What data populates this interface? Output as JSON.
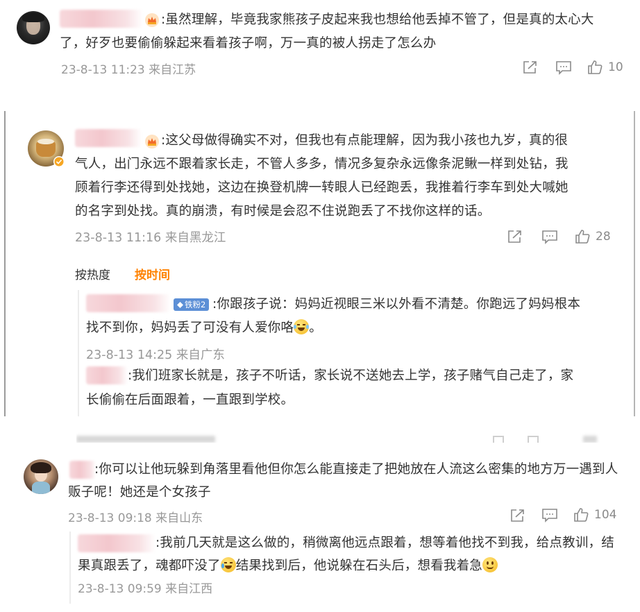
{
  "comments": [
    {
      "text": "虽然理解，毕竟我家熊孩子皮起来我也想给他丢掉不管了，但是真的太心大了，好歹也要偷偷躲起来看着孩子啊，万一真的被人拐走了怎么办",
      "text_line1": ":虽然理解，毕竟我家熊孩子皮起来我也想给他丢掉不管了，但是真的太心大",
      "text_line2": "了，好歹也要偷偷躲起来看着孩子啊，万一真的被人拐走了怎么办",
      "time": "23-8-13 11:23 来自江苏",
      "likes": "10"
    },
    {
      "line1": ":这父母做得确实不对，但我也有点能理解，因为我小孩也九岁，真的很",
      "line2": "气人，出门永远不跟着家长走，不管人多多，情况多复杂永远像条泥鳅一样到处钻，我",
      "line3": "顾着行李还得到处找她，这边在换登机牌一转眼人已经跑丢，我推着行李车到处大喊她",
      "line4": "的名字到处找。真的崩溃，有时候是会忍不住说跑丢了不找你这样的话。",
      "time": "23-8-13 11:16 来自黑龙江",
      "likes": "28",
      "sort_by_heat": "按热度",
      "sort_by_time": "按时间",
      "replies": [
        {
          "badge": "铁粉2",
          "line1": ":你跟孩子说：妈妈近视眼三米以外看不清楚。你跑远了妈妈根本",
          "line2": "找不到你，妈妈丢了可没有人爱你咯",
          "time": "23-8-13 14:25 来自广东"
        },
        {
          "line1": ":我们班家长就是，孩子不听话，家长说不送她去上学，孩子赌气自己走了，家",
          "line2": "长偷偷在后面跟着，一直跟到学校。"
        }
      ]
    },
    {
      "line1": ":你可以让他玩躲到角落里看他但你怎么能直接走了把她放在人流这么密集的地方万一遇到人",
      "line2": "贩子呢！她还是个女孩子",
      "time": "23-8-13 09:18 来自山东",
      "likes": "104",
      "replies": [
        {
          "line1": ":我前几天就是这么做的，稍微离他远点跟着，想等着他找不到我，给点教训，结",
          "line2a": "果真跟丢了，魂都吓没了",
          "line2b": "结果找到后，他说躲在石头后，想看我着急",
          "time": "23-8-13 09:59 来自江西"
        }
      ]
    }
  ],
  "icons": [
    "share-icon",
    "comment-icon",
    "like-icon",
    "crown-icon",
    "verified-icon"
  ],
  "colors": {
    "text": "#333333",
    "meta": "#999999",
    "accent_orange": "#ff8200",
    "badge_blue": "#5c8fd6",
    "blur_pink": "#f3c7cd"
  }
}
